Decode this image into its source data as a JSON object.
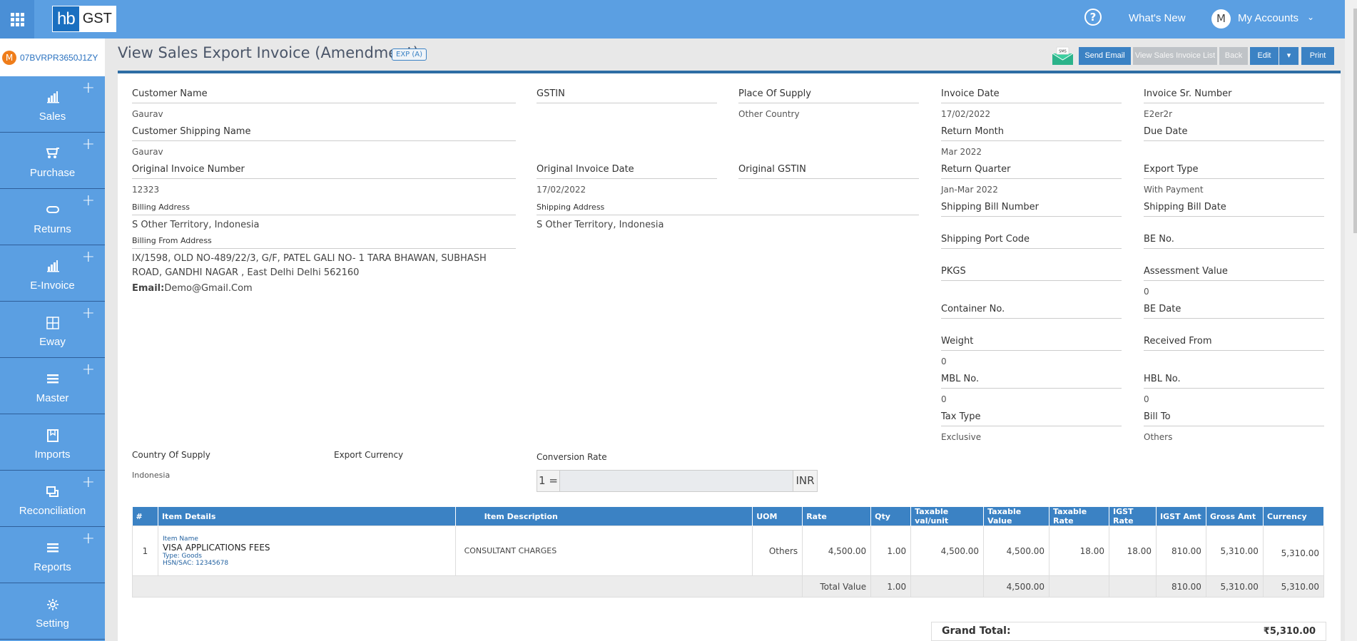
{
  "header": {
    "logo_hb": "hb",
    "logo_gst": "GST",
    "help_icon": "?",
    "whats_new": "What's New",
    "account_initial": "M",
    "my_accounts": "My Accounts",
    "caret": "⌄"
  },
  "gstin": {
    "badge": "M",
    "number": "07BVRPR3650J1ZY"
  },
  "sidebar": {
    "items": [
      {
        "label": "Sales",
        "icon": "bar-chart-icon",
        "glyph": "📶",
        "plus": "+"
      },
      {
        "label": "Purchase",
        "icon": "cart-icon",
        "glyph": "🛒",
        "plus": "+"
      },
      {
        "label": "Returns",
        "icon": "refresh-icon",
        "glyph": "⟳",
        "plus": "+"
      },
      {
        "label": "E-Invoice",
        "icon": "bar-chart-icon",
        "glyph": "📶",
        "plus": "+"
      },
      {
        "label": "Eway",
        "icon": "grid-icon",
        "glyph": "⊞",
        "plus": "+"
      },
      {
        "label": "Master",
        "icon": "menu-icon",
        "glyph": "☰",
        "plus": "+"
      },
      {
        "label": "Imports",
        "icon": "book-icon",
        "glyph": "⎘",
        "plus": ""
      },
      {
        "label": "Reconciliation",
        "icon": "copy-icon",
        "glyph": "❐",
        "plus": "+"
      },
      {
        "label": "Reports",
        "icon": "menu-icon",
        "glyph": "☰",
        "plus": "+"
      },
      {
        "label": "Setting",
        "icon": "gear-icon",
        "glyph": "⚙",
        "plus": ""
      }
    ]
  },
  "page": {
    "title": "View Sales Export Invoice (Amendment)",
    "badge": "EXP (A)"
  },
  "actions": {
    "sms_label": "SMS",
    "send_email": "Send Email",
    "view_list": "View Sales Invoice List",
    "back": "Back",
    "edit": "Edit",
    "edit_caret": "▾",
    "print": "Print"
  },
  "fields": {
    "customer_name": {
      "label": "Customer Name",
      "value": "Gaurav"
    },
    "customer_shipping_name": {
      "label": "Customer Shipping Name",
      "value": "Gaurav"
    },
    "original_invoice_number": {
      "label": "Original Invoice Number",
      "value": "12323"
    },
    "billing_address": {
      "label": "Billing Address",
      "value": "S Other Territory, Indonesia"
    },
    "billing_from_address": {
      "label": "Billing From Address",
      "value": "IX/1598, OLD NO-489/22/3, G/F, PATEL GALI NO- 1 TARA BHAWAN, SUBHASH ROAD, GANDHI NAGAR , East Delhi Delhi 562160"
    },
    "email": {
      "label": "Email:",
      "value": "Demo@Gmail.Com"
    },
    "gstin": {
      "label": "GSTIN",
      "value": ""
    },
    "place_of_supply": {
      "label": "Place Of Supply",
      "value": "Other Country"
    },
    "original_invoice_date": {
      "label": "Original Invoice Date",
      "value": "17/02/2022"
    },
    "original_gstin": {
      "label": "Original GSTIN",
      "value": ""
    },
    "shipping_address": {
      "label": "Shipping Address",
      "value": "S Other Territory, Indonesia"
    },
    "invoice_date": {
      "label": "Invoice Date",
      "value": "17/02/2022"
    },
    "invoice_sr_number": {
      "label": "Invoice Sr. Number",
      "value": "E2er2r"
    },
    "return_month": {
      "label": "Return Month",
      "value": "Mar 2022"
    },
    "due_date": {
      "label": "Due Date",
      "value": ""
    },
    "return_quarter": {
      "label": "Return Quarter",
      "value": "Jan-Mar 2022"
    },
    "export_type": {
      "label": "Export Type",
      "value": "With Payment"
    },
    "shipping_bill_number": {
      "label": "Shipping Bill Number",
      "value": ""
    },
    "shipping_bill_date": {
      "label": "Shipping Bill Date",
      "value": ""
    },
    "shipping_port_code": {
      "label": "Shipping Port Code",
      "value": ""
    },
    "be_no": {
      "label": "BE No.",
      "value": ""
    },
    "pkgs": {
      "label": "PKGS",
      "value": ""
    },
    "assessment_value": {
      "label": "Assessment Value",
      "value": "0"
    },
    "container_no": {
      "label": "Container No.",
      "value": ""
    },
    "be_date": {
      "label": "BE Date",
      "value": ""
    },
    "weight": {
      "label": "Weight",
      "value": "0"
    },
    "received_from": {
      "label": "Received From",
      "value": ""
    },
    "mbl_no": {
      "label": "MBL No.",
      "value": "0"
    },
    "hbl_no": {
      "label": "HBL No.",
      "value": "0"
    },
    "tax_type": {
      "label": "Tax Type",
      "value": "Exclusive"
    },
    "bill_to": {
      "label": "Bill To",
      "value": "Others"
    },
    "country_of_supply": {
      "label": "Country Of Supply",
      "value": "Indonesia"
    },
    "export_currency": {
      "label": "Export Currency",
      "value": ""
    },
    "conversion_rate": {
      "label": "Conversion Rate",
      "prefix": "1 =",
      "value": "",
      "suffix": "INR"
    }
  },
  "table": {
    "headers": [
      "#",
      "Item Details",
      "Item Description",
      "UOM",
      "Rate",
      "Qty",
      "Taxable val/unit",
      "Taxable Value",
      "Taxable Rate",
      "IGST Rate",
      "IGST Amt",
      "Gross Amt",
      "Currency"
    ],
    "rows": [
      {
        "index": "1",
        "item_name_label": "Item Name",
        "item_name": "VISA APPLICATIONS FEES",
        "type": "Type: Goods",
        "hsn": "HSN/SAC: 12345678",
        "description": "CONSULTANT CHARGES",
        "uom": "Others",
        "rate": "4,500.00",
        "qty": "1.00",
        "taxable_per_unit": "4,500.00",
        "taxable_value": "4,500.00",
        "taxable_rate": "18.00",
        "igst_rate": "18.00",
        "igst_amt": "810.00",
        "gross_amt": "5,310.00",
        "currency": "5,310.00"
      }
    ],
    "total": {
      "label": "Total Value",
      "qty": "1.00",
      "taxable_value": "4,500.00",
      "igst_amt": "810.00",
      "gross_amt": "5,310.00",
      "currency": "5,310.00"
    }
  },
  "grand_total": {
    "label": "Grand Total:",
    "value": "₹5,310.00"
  }
}
